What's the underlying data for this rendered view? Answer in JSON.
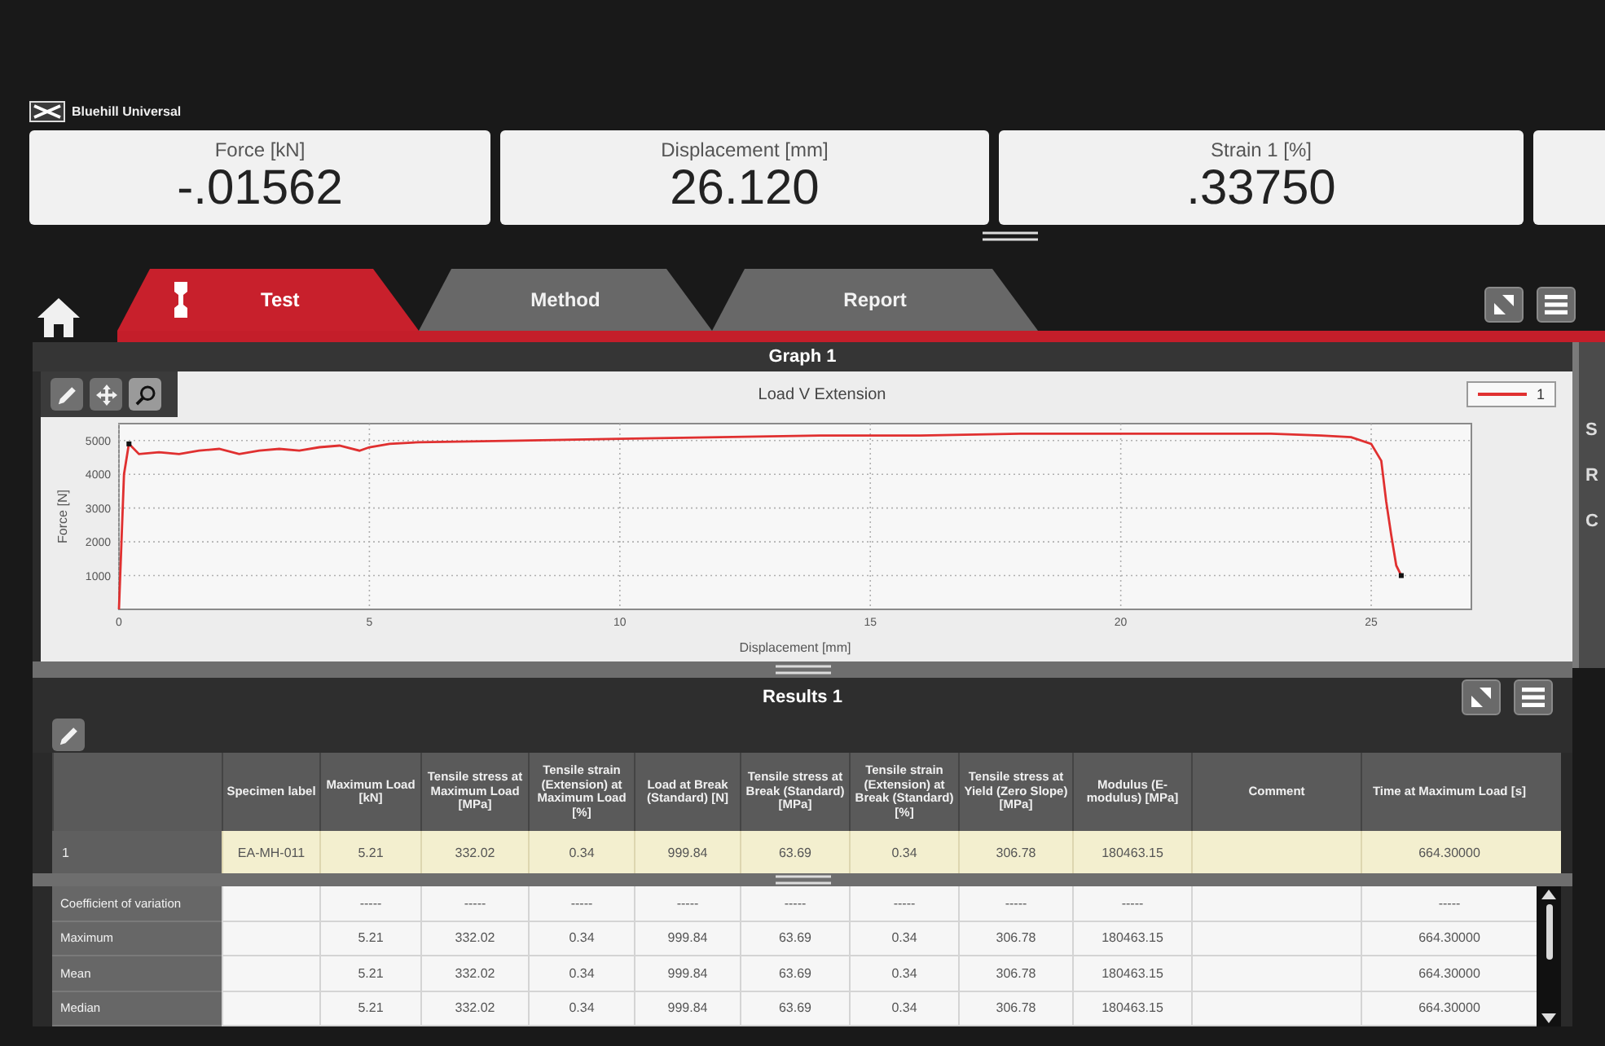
{
  "app": {
    "name": "Bluehill Universal"
  },
  "readouts": [
    {
      "label": "Force [kN]",
      "value": "-.01562"
    },
    {
      "label": "Displacement [mm]",
      "value": "26.120"
    },
    {
      "label": "Strain 1 [%]",
      "value": ".33750"
    }
  ],
  "tabs": [
    {
      "label": "Test",
      "selected": true,
      "kind": "icon"
    },
    {
      "label": "Method",
      "selected": false,
      "kind": "text"
    },
    {
      "label": "Report",
      "selected": false,
      "kind": "text"
    }
  ],
  "graph": {
    "title": "Graph 1",
    "chart_data": {
      "type": "line",
      "title": "Load V Extension",
      "xlabel": "Displacement [mm]",
      "ylabel": "Force [N]",
      "grid": true,
      "x": [
        0,
        0.1,
        0.2,
        0.4,
        0.8,
        1.2,
        1.6,
        2.0,
        2.4,
        2.8,
        3.2,
        3.6,
        4.0,
        4.4,
        4.8,
        5.0,
        5.4,
        6,
        8,
        10,
        12,
        14,
        16,
        18,
        20,
        22,
        23,
        24,
        24.6,
        25.0,
        25.2,
        25.3,
        25.4,
        25.5,
        25.6
      ],
      "series": [
        {
          "name": "1",
          "color": "#e03030",
          "values": [
            0,
            4000,
            4900,
            4600,
            4650,
            4600,
            4700,
            4750,
            4600,
            4700,
            4750,
            4700,
            4800,
            4850,
            4700,
            4800,
            4900,
            4950,
            5000,
            5050,
            5100,
            5150,
            5150,
            5200,
            5200,
            5200,
            5200,
            5150,
            5100,
            4900,
            4400,
            3200,
            2200,
            1300,
            1000
          ]
        }
      ],
      "xlim": [
        0,
        27
      ],
      "ylim": [
        0,
        5500
      ],
      "xticks": [
        0,
        5,
        10,
        15,
        20,
        25
      ],
      "yticks": [
        1000,
        2000,
        3000,
        4000,
        5000
      ]
    }
  },
  "results": {
    "title": "Results 1",
    "columns": [
      "Specimen label",
      "Maximum Load [kN]",
      "Tensile stress at Maximum Load [MPa]",
      "Tensile strain (Extension) at Maximum Load [%]",
      "Load at Break (Standard) [N]",
      "Tensile stress at Break (Standard) [MPa]",
      "Tensile strain (Extension) at Break (Standard) [%]",
      "Tensile stress at Yield (Zero Slope) [MPa]",
      "Modulus (E-modulus) [MPa]",
      "Comment",
      "Time at Maximum Load [s]"
    ],
    "rows": [
      {
        "label": "1",
        "selected": true,
        "cells": [
          "EA-MH-011",
          "5.21",
          "332.02",
          "0.34",
          "999.84",
          "63.69",
          "0.34",
          "306.78",
          "180463.15",
          null,
          "664.30000"
        ]
      }
    ],
    "statistics": [
      {
        "label": "Coefficient of variation",
        "cells": [
          null,
          "-----",
          "-----",
          "-----",
          "-----",
          "-----",
          "-----",
          "-----",
          "-----",
          null,
          "-----"
        ]
      },
      {
        "label": "Maximum",
        "cells": [
          null,
          "5.21",
          "332.02",
          "0.34",
          "999.84",
          "63.69",
          "0.34",
          "306.78",
          "180463.15",
          null,
          "664.30000"
        ]
      },
      {
        "label": "Mean",
        "cells": [
          null,
          "5.21",
          "332.02",
          "0.34",
          "999.84",
          "63.69",
          "0.34",
          "306.78",
          "180463.15",
          null,
          "664.30000"
        ]
      },
      {
        "label": "Median",
        "cells": [
          null,
          "5.21",
          "332.02",
          "0.34",
          "999.84",
          "63.69",
          "0.34",
          "306.78",
          "180463.15",
          null,
          "664.30000"
        ]
      }
    ]
  },
  "side_panel": {
    "items": [
      "S",
      "R",
      "C"
    ]
  }
}
